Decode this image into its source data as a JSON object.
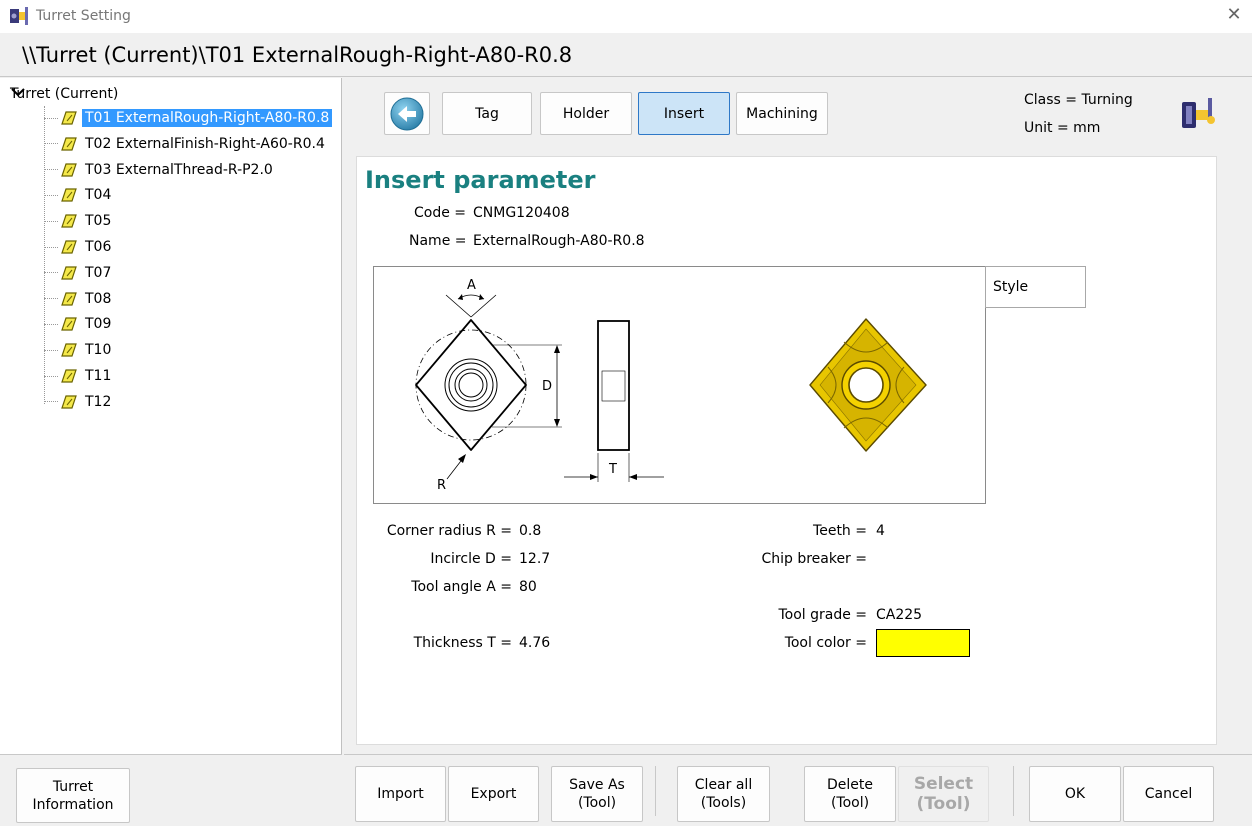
{
  "window": {
    "title": "Turret Setting"
  },
  "path": "\\\\Turret (Current)\\T01 ExternalRough-Right-A80-R0.8",
  "tree": {
    "root": "Turret (Current)",
    "items": [
      "T01 ExternalRough-Right-A80-R0.8",
      "T02 ExternalFinish-Right-A60-R0.4",
      "T03 ExternalThread-R-P2.0",
      "T04",
      "T05",
      "T06",
      "T07",
      "T08",
      "T09",
      "T10",
      "T11",
      "T12"
    ],
    "selected_index": 0
  },
  "tabs": {
    "tag": "Tag",
    "holder": "Holder",
    "insert": "Insert",
    "machining": "Machining",
    "active": "insert"
  },
  "info": {
    "class": "Class = Turning",
    "unit": "Unit = mm"
  },
  "insert": {
    "heading": "Insert parameter",
    "code_label": "Code =",
    "code_value": "CNMG120408",
    "name_label": "Name =",
    "name_value": "ExternalRough-A80-R0.8",
    "style_label": "Style",
    "drawing": {
      "angle": "A",
      "incircle": "D",
      "radius": "R",
      "thickness": "T"
    },
    "corner_radius_label": "Corner radius R =",
    "corner_radius_value": "0.8",
    "incircle_label": "Incircle D =",
    "incircle_value": "12.7",
    "tool_angle_label": "Tool angle A =",
    "tool_angle_value": "80",
    "thickness_label": "Thickness T =",
    "thickness_value": "4.76",
    "teeth_label": "Teeth =",
    "teeth_value": "4",
    "chip_breaker_label": "Chip breaker =",
    "chip_breaker_value": "",
    "tool_grade_label": "Tool grade =",
    "tool_grade_value": "CA225",
    "tool_color_label": "Tool color =",
    "tool_color": "#ffff00"
  },
  "buttons": {
    "turret_info": "Turret\nInformation",
    "import": "Import",
    "export": "Export",
    "save_as": "Save As\n(Tool)",
    "clear_all": "Clear all\n(Tools)",
    "delete": "Delete\n(Tool)",
    "select": "Select\n(Tool)",
    "ok": "OK",
    "cancel": "Cancel"
  },
  "colors": {
    "accent": "#1a8080",
    "selection": "#3399ff",
    "insert_gold": "#d4b000"
  },
  "icons": {
    "app": "turret-app-icon",
    "back": "back-arrow-icon",
    "close": "close-icon",
    "tool": "insert-tool-icon",
    "corner": "turret-tool-icon"
  }
}
